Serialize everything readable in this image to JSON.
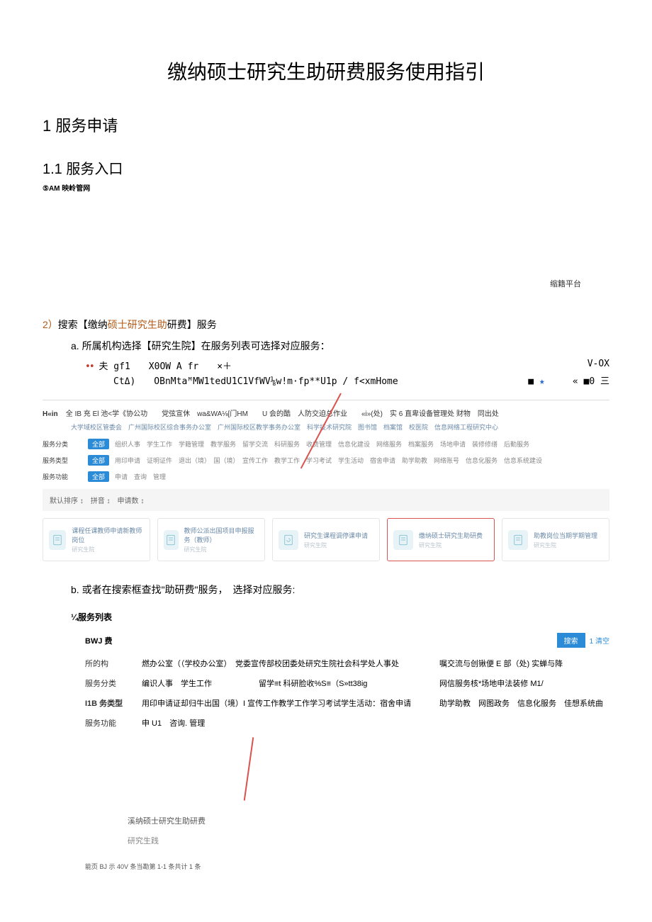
{
  "title": "缴纳硕士研究生助研费服务使用指引",
  "h1_1": "1 服务申请",
  "h1_1_1": "1.1 服务入口",
  "small_line": "⑤AM 映岭管网",
  "platform_label": "缩籍平台",
  "step2": {
    "num": "2）",
    "pre": "搜索【缴纳",
    "kw": "硕士研究生助",
    "post": "研费】服务"
  },
  "step2a": "a. 所属机构选择【研究生院】在服务列表可选择对应服务：",
  "garble1": {
    "dots": "••",
    "l": "夫 gf1　　X0OW A fr　　×＋",
    "r": "V-OX"
  },
  "garble2": {
    "l": "CtΔ)　　OBnMtaᴹMW1tedU1C1VfWV⅛w!m·fp**U1p / f<xmHome",
    "sq1": "■",
    "star": "★",
    "r": "« ■0 三"
  },
  "tophdr": {
    "b1": "H«in",
    "t": "全 IB 充 El 池<学《协公功　　党弦宣休　wa&WA⅛[门HM　　U 会的酷　人防交迫总作业　　«i»(处)　实 6 直卑设备管理处 财物　同出处"
  },
  "subtabs": "大学域校区管委会　广州国际校区综合事务办公室　广州国际校区教学事务办公室　科学技术研究院　图书馆　档案馆　校医院　信息网络工程研究中心",
  "filter1": {
    "label": "服务分类",
    "all": "全部",
    "opts": "组织人事　学生工作　学籍管理　教学服务　留学交流　科研服务　收费管理　信息化建设　网络服务　档案服务　场地申请　装修修缮　后勤服务"
  },
  "filter2": {
    "label": "服务类型",
    "all": "全部",
    "opts": "用印申请　证明证件　退出（境）　国（境）　宣传工作　教学工作　学习考试　学生活动　宿舍申请　助学助教　网络账号　信息化服务　信息系统建设"
  },
  "filter3": {
    "label": "服务功能",
    "all": "全部",
    "opts": "申请　查询　管理"
  },
  "sortbar": "默认排序 ↕　拼音 ↕　申请数 ↕",
  "cards": [
    {
      "title": "课程任课教师申请新教师岗位",
      "sub": "研究生院"
    },
    {
      "title": "教师公派出国项目申报服务（教师）",
      "sub": "研究生院"
    },
    {
      "title": "研究生课程调停课申请",
      "sub": "研究生院"
    },
    {
      "title": "缴纳硕士研究生助研费",
      "sub": "研究生院"
    },
    {
      "title": "助教岗位当期学期管理",
      "sub": "研究生院"
    }
  ],
  "step2b": "b. 或者在搜索框查找\"助研费\"服务，　选择对应服务:",
  "svc_list_title": "¼服务列表",
  "bwj": "BWJ 费",
  "btn_search": "搜索",
  "clear": "1 清空",
  "f": {
    "org": {
      "label": "所的构",
      "opts": "燃办公室（（学校办公室）　党委宣传部校团委处研究生院社会科学处人事处",
      "r": "嘱交流与创锹便 E 部（处) 实蝉与降"
    },
    "cat": {
      "label": "服务分类",
      "opts": "编识人事　学生工作　　　　　　留学≡t 科研脸收%S≡（S»tt38ig",
      "r": "网信服务核*场地申法装修 M1/"
    },
    "type": {
      "label": "I1B 务类型",
      "opts": "用印申请证却归牛出国（境）I 宣传工作教学工作学习考试学生活动：宿舍申请",
      "r": "助学助教　网图政务　信息化服务　佳想系统曲"
    },
    "func": {
      "label": "服务功能",
      "opts": "申 U1　咨询. 管理"
    }
  },
  "result": {
    "title": "溪纳硕士研究生助研费",
    "sub": "研究生践"
  },
  "pager": "能页 BJ 示 40V 条当勘第 1-1 条共计 1 条"
}
